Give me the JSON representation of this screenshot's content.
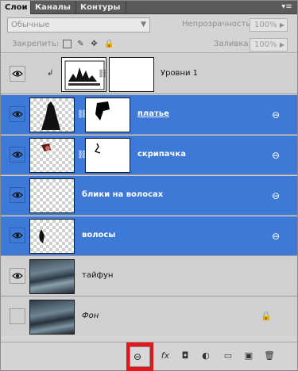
{
  "tabs": [
    {
      "label": "Слои",
      "active": true
    },
    {
      "label": "Каналы",
      "active": false
    },
    {
      "label": "Контуры",
      "active": false
    }
  ],
  "menu_icon": "panel-menu-icon",
  "blend_mode": {
    "value": "Обычные"
  },
  "opacity": {
    "label": "Непрозрачность:",
    "value": "100%"
  },
  "lock": {
    "label": "Закрепить:"
  },
  "fill": {
    "label": "Заливка:",
    "value": "100%"
  },
  "layers": [
    {
      "name": "Уровни 1",
      "visible": true,
      "selected": false,
      "type": "adjustment-levels"
    },
    {
      "name": "платье",
      "visible": true,
      "selected": true,
      "type": "image-with-mask"
    },
    {
      "name": "скрипачка",
      "visible": true,
      "selected": true,
      "type": "image-with-mask"
    },
    {
      "name": "блики на волосах",
      "visible": true,
      "selected": true,
      "type": "image"
    },
    {
      "name": "волосы",
      "visible": true,
      "selected": true,
      "type": "image"
    },
    {
      "name": "тайфун",
      "visible": true,
      "selected": false,
      "type": "image"
    },
    {
      "name": "Фон",
      "visible": false,
      "selected": false,
      "type": "background"
    }
  ],
  "bottom_icons": [
    "link-layers-icon",
    "fx-icon",
    "add-mask-icon",
    "adjustment-layer-icon",
    "new-group-icon",
    "new-layer-icon",
    "trash-icon"
  ],
  "colors": {
    "selection": "#3d7ad7",
    "highlight": "#e4151c"
  }
}
